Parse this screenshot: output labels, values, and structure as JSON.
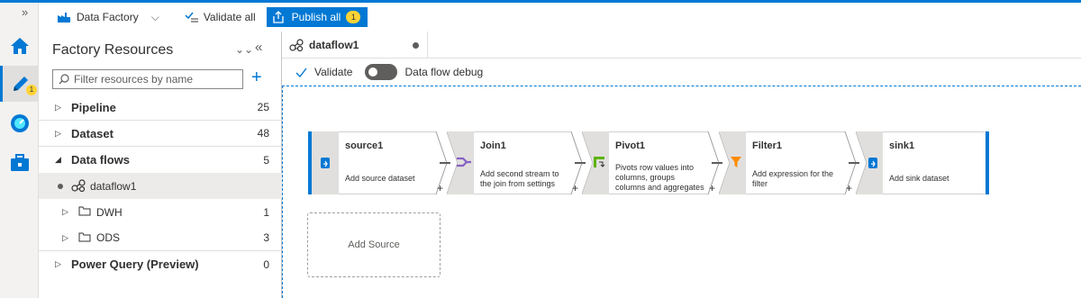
{
  "toolbar": {
    "data_factory_label": "Data Factory",
    "validate_all_label": "Validate all",
    "publish_all_label": "Publish all",
    "publish_badge": "1"
  },
  "rail": {
    "author_badge": "1",
    "items": [
      "home-icon",
      "pencil-icon",
      "monitor-icon",
      "toolbox-icon"
    ]
  },
  "panel": {
    "title": "Factory Resources",
    "search_placeholder": "Filter resources by name",
    "tree": [
      {
        "label": "Pipeline",
        "count": "25"
      },
      {
        "label": "Dataset",
        "count": "48"
      },
      {
        "label": "Data flows",
        "count": "5"
      },
      {
        "label": "dataflow1"
      },
      {
        "label": "DWH",
        "count": "1"
      },
      {
        "label": "ODS",
        "count": "3"
      },
      {
        "label": "Power Query (Preview)",
        "count": "0"
      }
    ]
  },
  "tab": {
    "label": "dataflow1"
  },
  "canvas_toolbar": {
    "validate_label": "Validate",
    "debug_label": "Data flow debug",
    "debug_on": false
  },
  "flow": {
    "nodes": [
      {
        "title": "source1",
        "desc": "Add source dataset"
      },
      {
        "title": "Join1",
        "desc": "Add second stream to the join from settings"
      },
      {
        "title": "Pivot1",
        "desc": "Pivots row values into columns, groups columns and aggregates data"
      },
      {
        "title": "Filter1",
        "desc": "Add expression for the filter"
      },
      {
        "title": "sink1",
        "desc": "Add sink dataset"
      }
    ],
    "add_source_label": "Add Source"
  },
  "colors": {
    "accent": "#0078d4",
    "badge": "#ffd335",
    "rail": "#f3f2f1"
  }
}
